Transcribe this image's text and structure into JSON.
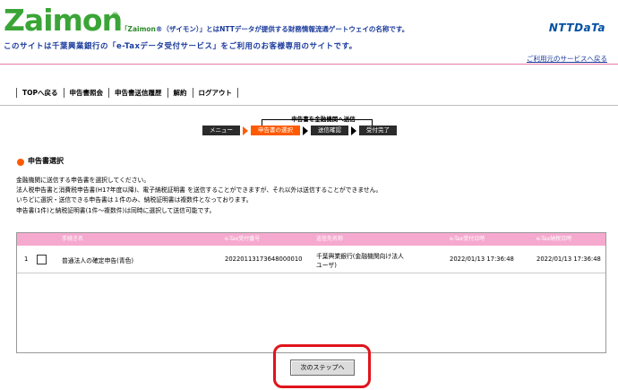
{
  "header": {
    "logo": "Zaimon",
    "logo_mark": "®",
    "tagline_brand": "「Zaimon",
    "tagline_rest": "®（ザイモン）」とはNTTデータが提供する財務情報流通ゲートウェイの名称です。",
    "tagline2": "このサイトは千葉興業銀行の「e-Taxデータ受付サービス」をご利用のお客様専用のサイトです。",
    "ntt_logo": "NTTDaTa",
    "return_link": "ご利用元のサービスへ戻る"
  },
  "nav": {
    "items": [
      "TOPへ戻る",
      "申告書照会",
      "申告書送信履歴",
      "解約",
      "ログアウト"
    ]
  },
  "steps": {
    "caption": "申告書を金融機関へ送信",
    "items": [
      "メニュー",
      "申告書の選択",
      "送信確認",
      "受付完了"
    ],
    "active_index": 1
  },
  "section": {
    "title": "申告書選択",
    "lines": [
      "金融機関に送信する申告書を選択してください。",
      "法人税申告書と消費税申告書(H17年度以降)、電子納税証明書 を送信することができますが、それ以外は送信することができません。",
      "いちどに選択・送信できる申告書は１件のみ、納税証明書は複数件となっております。",
      "申告書(1件)と納税証明書(1件～複数件)は同時に選択して送信可能です。"
    ]
  },
  "table": {
    "headers": [
      "手続き名",
      "e-Tax受付番号",
      "送信先名称",
      "e-Tax受付日時",
      "e-Tax納税日時"
    ],
    "rows": [
      {
        "index": "1",
        "name": "普通法人の確定申告(青色)",
        "receipt_no": "20220113173648000010",
        "dest_line1": "千葉興業銀行(金融機関向け法人",
        "dest_line2": "ユーザ)",
        "received": "2022/01/13 17:36:48",
        "paid": "2022/01/13 17:36:48",
        "checked": false
      }
    ]
  },
  "next_button": "次のステップへ",
  "colors": {
    "accent": "#ff5a00",
    "pink": "#f6a9cf",
    "highlight": "#e0141c",
    "brand_green": "#3aa536"
  }
}
